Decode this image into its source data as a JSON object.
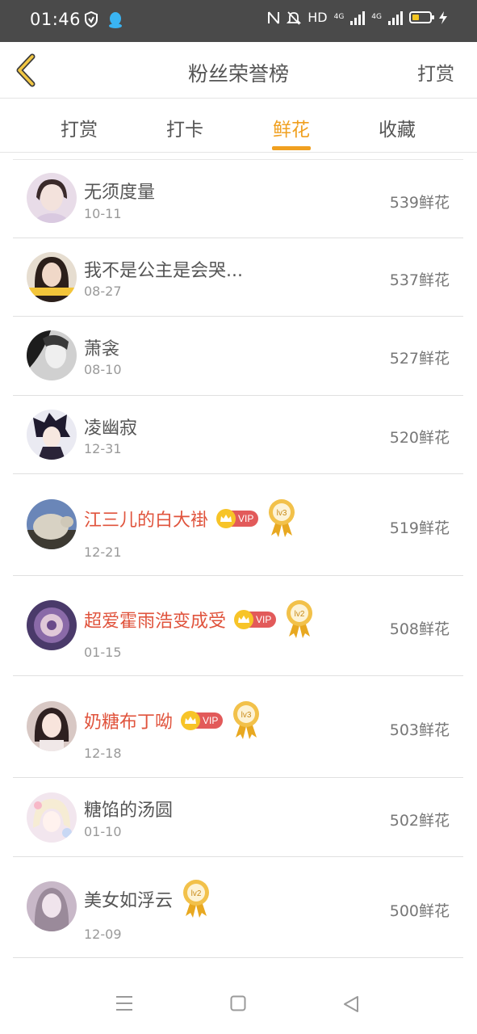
{
  "status_bar": {
    "time": "01:46",
    "network": "HD",
    "signal1": "4G",
    "signal2": "4G"
  },
  "header": {
    "back_icon": "chevron-left-icon",
    "title": "粉丝荣誉榜",
    "action": "打赏"
  },
  "tabs": [
    {
      "label": "打赏",
      "active": false
    },
    {
      "label": "打卡",
      "active": false
    },
    {
      "label": "鲜花",
      "active": true
    },
    {
      "label": "收藏",
      "active": false
    }
  ],
  "fans": [
    {
      "name": "无须度量",
      "date": "10-11",
      "count": "539鲜花"
    },
    {
      "name": "我不是公主是会哭...",
      "date": "08-27",
      "count": "537鲜花"
    },
    {
      "name": "萧衾",
      "date": "08-10",
      "count": "527鲜花"
    },
    {
      "name": "凌幽寂",
      "date": "12-31",
      "count": "520鲜花"
    },
    {
      "name": "江三儿的白大褂",
      "date": "12-21",
      "count": "519鲜花",
      "vip": "VIP",
      "level": "lv3"
    },
    {
      "name": "超爱霍雨浩变成受",
      "date": "01-15",
      "count": "508鲜花",
      "vip": "VIP",
      "level": "lv2"
    },
    {
      "name": "奶糖布丁呦",
      "date": "12-18",
      "count": "503鲜花",
      "vip": "VIP",
      "level": "lv3"
    },
    {
      "name": "糖馅的汤圆",
      "date": "01-10",
      "count": "502鲜花"
    },
    {
      "name": "美女如浮云",
      "date": "12-09",
      "count": "500鲜花",
      "level": "lv2"
    }
  ],
  "colors": {
    "accent": "#f0a020",
    "vip_name": "#e0533c",
    "vip_badge": "#e25a5a",
    "crown": "#f7c428",
    "status_bar": "#4a4a4a"
  },
  "nav_icons": [
    "menu-icon",
    "home-square-icon",
    "back-triangle-icon"
  ]
}
